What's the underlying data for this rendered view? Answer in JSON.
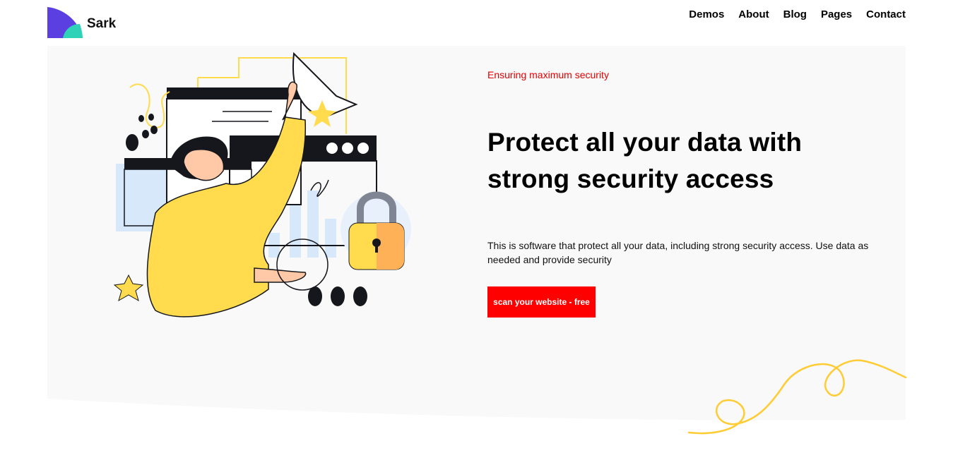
{
  "brand": {
    "name": "Sark"
  },
  "nav": {
    "items": [
      {
        "label": "Demos"
      },
      {
        "label": "About"
      },
      {
        "label": "Blog"
      },
      {
        "label": "Pages"
      },
      {
        "label": "Contact"
      }
    ]
  },
  "hero": {
    "eyebrow": "Ensuring maximum security",
    "headline_line1": "Protect all your data with",
    "headline_line2": "strong security access",
    "description": "This is software that protect all your data, including strong security access. Use data as needed and provide security",
    "cta_label": "scan your website - free"
  },
  "colors": {
    "accent": "#ff0000",
    "hero_background": "#f9f9f9",
    "illustration_yellow": "#ffdb4d",
    "lock_orange": "#ffb158",
    "logo_purple": "#5b3fe0",
    "logo_teal": "#2ed3b7"
  },
  "icons": {
    "logo": "shark-fin-logo-icon",
    "lock": "padlock-icon"
  }
}
